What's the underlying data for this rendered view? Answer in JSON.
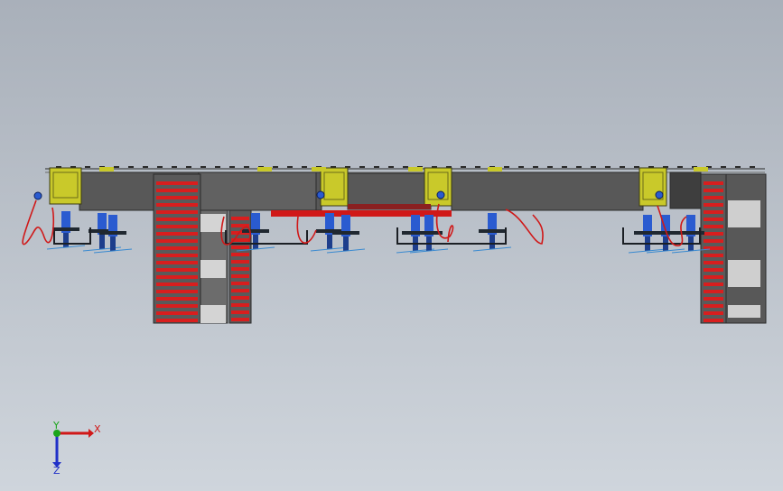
{
  "viewport": {
    "background_top": "#a9b0ba",
    "background_bottom": "#cfd5dc"
  },
  "colors": {
    "beam": "#585858",
    "beam_dark": "#3e3e3e",
    "column": "#5a5a5a",
    "rack_slat": "#d81e1e",
    "bracket": "#c9c92a",
    "cable": "#d01818",
    "gripper": "#2a5bd0",
    "panel_light": "#d4d4d4"
  },
  "triad": {
    "x_label": "X",
    "y_label": "Y",
    "z_label": "Z",
    "x_color": "#d01818",
    "y_color": "#1aa51a",
    "z_color": "#2030c8"
  }
}
